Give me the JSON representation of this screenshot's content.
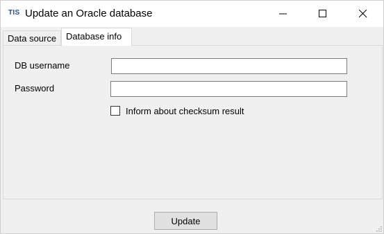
{
  "window": {
    "app_icon_text": "TIS",
    "title": "Update an Oracle database"
  },
  "tabs": [
    {
      "label": "Data source",
      "selected": false
    },
    {
      "label": "Database info",
      "selected": true
    }
  ],
  "form": {
    "username_label": "DB username",
    "username_value": "",
    "password_label": "Password",
    "password_value": "",
    "checksum_label": "Inform about checksum result",
    "checksum_checked": false
  },
  "footer": {
    "update_label": "Update"
  },
  "colors": {
    "app_icon": "#1a4fa3",
    "window_bg": "#f0f0f0",
    "titlebar_bg": "#ffffff"
  }
}
